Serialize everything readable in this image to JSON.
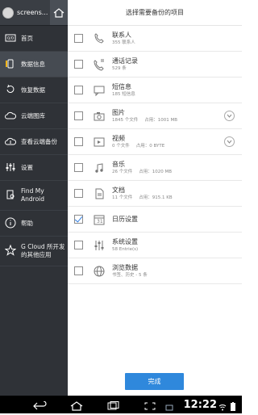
{
  "sidebar": {
    "header": {
      "title": "screens..."
    },
    "items": [
      {
        "label": "首页"
      },
      {
        "label": "数据信息"
      },
      {
        "label": "恢复数据"
      },
      {
        "label": "云端图库"
      },
      {
        "label": "查看云端备份"
      },
      {
        "label": "设置"
      },
      {
        "label": "Find My Android"
      },
      {
        "label": "帮助"
      },
      {
        "label": "G Cloud 所开发的其他应用"
      }
    ]
  },
  "main": {
    "title": "选择需要备份的项目",
    "items": [
      {
        "title": "联系人",
        "sub1": "355 联系人",
        "sub2": "",
        "checked": false,
        "expand": false
      },
      {
        "title": "通话记录",
        "sub1": "529 条",
        "sub2": "",
        "checked": false,
        "expand": false
      },
      {
        "title": "短信息",
        "sub1": "185 短信息",
        "sub2": "",
        "checked": false,
        "expand": false
      },
      {
        "title": "图片",
        "sub1": "1845 个文件",
        "sub2": "占用：1001 MB",
        "checked": false,
        "expand": true
      },
      {
        "title": "视频",
        "sub1": "0 个文件",
        "sub2": "占用：0 BYTE",
        "checked": false,
        "expand": true
      },
      {
        "title": "音乐",
        "sub1": "26 个文件",
        "sub2": "占用：1020 MB",
        "checked": false,
        "expand": false
      },
      {
        "title": "文档",
        "sub1": "11 个文件",
        "sub2": "占用：915.1 KB",
        "checked": false,
        "expand": false
      },
      {
        "title": "日历设置",
        "sub1": "",
        "sub2": "",
        "checked": true,
        "expand": false
      },
      {
        "title": "系统设置",
        "sub1": "58 Entrie(s)",
        "sub2": "",
        "checked": false,
        "expand": false
      },
      {
        "title": "浏览数据",
        "sub1": "书签、历史 - 5 条",
        "sub2": "",
        "checked": false,
        "expand": false
      }
    ],
    "done_label": "完成"
  },
  "status": {
    "time": "12:22"
  },
  "colors": {
    "sidebar": "#2f3237",
    "accent": "#2f88dc"
  }
}
